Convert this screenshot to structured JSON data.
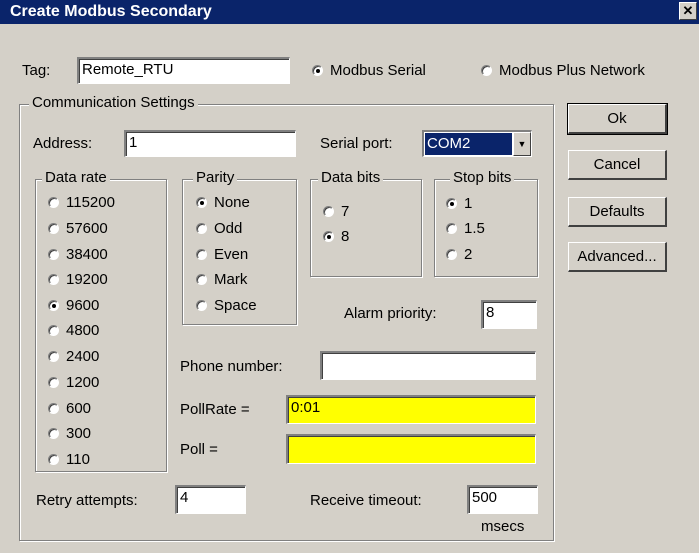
{
  "window": {
    "title": "Create Modbus Secondary",
    "close_glyph": "✕"
  },
  "tag": {
    "label": "Tag:",
    "value": "Remote_RTU"
  },
  "mode": {
    "options": [
      {
        "label": "Modbus Serial",
        "checked": true
      },
      {
        "label": "Modbus Plus Network",
        "checked": false
      }
    ]
  },
  "comm": {
    "label": "Communication Settings"
  },
  "address": {
    "label": "Address:",
    "value": "1"
  },
  "serial_port": {
    "label": "Serial port:",
    "value": "COM2"
  },
  "data_rate": {
    "label": "Data rate",
    "options": [
      {
        "label": "115200",
        "checked": false
      },
      {
        "label": "57600",
        "checked": false
      },
      {
        "label": "38400",
        "checked": false
      },
      {
        "label": "19200",
        "checked": false
      },
      {
        "label": "9600",
        "checked": true
      },
      {
        "label": "4800",
        "checked": false
      },
      {
        "label": "2400",
        "checked": false
      },
      {
        "label": "1200",
        "checked": false
      },
      {
        "label": "600",
        "checked": false
      },
      {
        "label": "300",
        "checked": false
      },
      {
        "label": "110",
        "checked": false
      }
    ]
  },
  "parity": {
    "label": "Parity",
    "options": [
      {
        "label": "None",
        "checked": true
      },
      {
        "label": "Odd",
        "checked": false
      },
      {
        "label": "Even",
        "checked": false
      },
      {
        "label": "Mark",
        "checked": false
      },
      {
        "label": "Space",
        "checked": false
      }
    ]
  },
  "data_bits": {
    "label": "Data bits",
    "options": [
      {
        "label": "7",
        "checked": false
      },
      {
        "label": "8",
        "checked": true
      }
    ]
  },
  "stop_bits": {
    "label": "Stop bits",
    "options": [
      {
        "label": "1",
        "checked": true
      },
      {
        "label": "1.5",
        "checked": false
      },
      {
        "label": "2",
        "checked": false
      }
    ]
  },
  "alarm_priority": {
    "label": "Alarm priority:",
    "value": "8"
  },
  "phone": {
    "label": "Phone number:",
    "value": ""
  },
  "pollrate": {
    "label": "PollRate =",
    "value": "0:01"
  },
  "poll": {
    "label": "Poll =",
    "value": ""
  },
  "retry": {
    "label": "Retry attempts:",
    "value": "4"
  },
  "timeout": {
    "label": "Receive timeout:",
    "value": "500",
    "unit": "msecs"
  },
  "buttons": {
    "ok": "Ok",
    "cancel": "Cancel",
    "defaults": "Defaults",
    "advanced": "Advanced..."
  },
  "colors": {
    "titlebar": "#0a246a",
    "face": "#d4d0c8",
    "highlight_field": "#ffff00"
  }
}
